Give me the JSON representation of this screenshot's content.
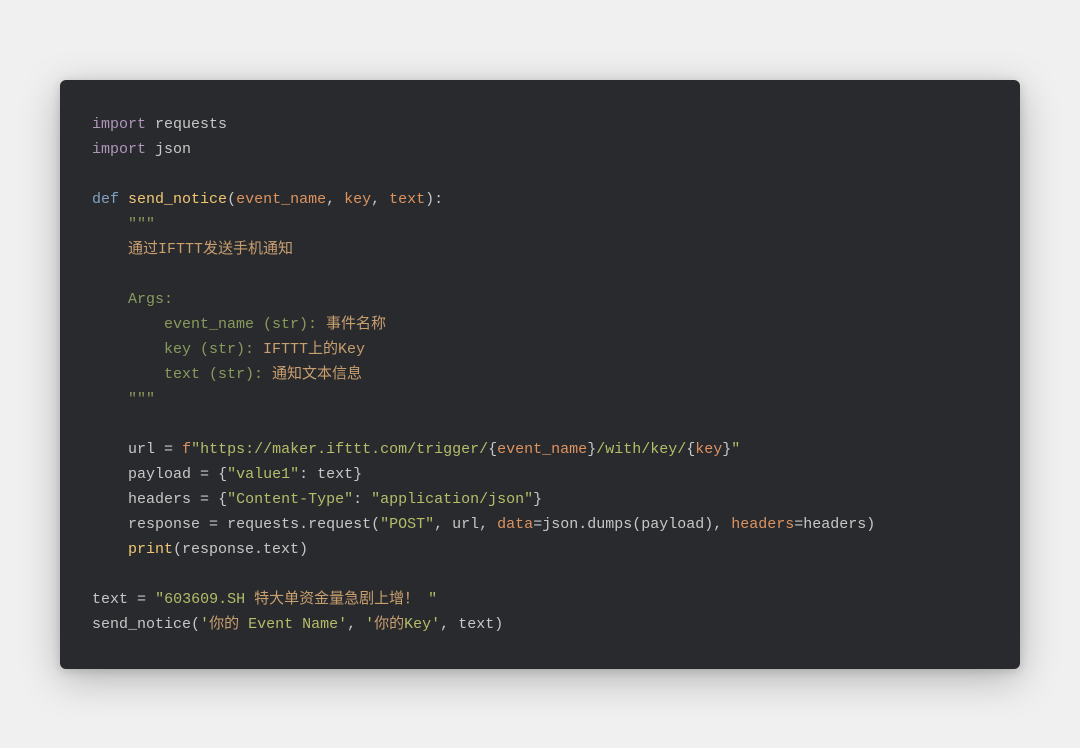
{
  "code": {
    "line1": {
      "kw": "import",
      "mod": "requests"
    },
    "line2": {
      "kw": "import",
      "mod": "json"
    },
    "line4": {
      "kw": "def",
      "fn": "send_notice",
      "p1": "event_name",
      "p2": "key",
      "p3": "text"
    },
    "line5": "\"\"\"",
    "line6": "通过IFTTT发送手机通知",
    "line8": "Args:",
    "line9a": "event_name (str): ",
    "line9b": "事件名称",
    "line10a": "key (str): ",
    "line10b": "IFTTT上的Key",
    "line11a": "text (str): ",
    "line11b": "通知文本信息",
    "line12": "\"\"\"",
    "line14_var": "url",
    "line14_fprefix": "f",
    "line14_s1": "\"https://maker.ifttt.com/trigger/",
    "line14_i1": "event_name",
    "line14_s2": "/with/key/",
    "line14_i2": "key",
    "line14_s3": "\"",
    "line15_var": "payload",
    "line15_key": "\"value1\"",
    "line15_val": "text",
    "line16_var": "headers",
    "line16_key": "\"Content-Type\"",
    "line16_val": "\"application/json\"",
    "line17_var": "response",
    "line17_call1": "requests.request(",
    "line17_post": "\"POST\"",
    "line17_url": "url",
    "line17_data": "data",
    "line17_json": "json.dumps(payload)",
    "line17_hdrs": "headers",
    "line17_hdrs2": "headers)",
    "line18_print": "print",
    "line18_arg": "(response.text)",
    "line20_var": "text",
    "line20_s1": "\"603609.SH ",
    "line20_s2": "特大单资金量急剧上增！",
    "line20_s3": " \"",
    "line21_fn": "send_notice",
    "line21_a1a": "'",
    "line21_a1b": "你的",
    "line21_a1c": " Event Name'",
    "line21_a2a": "'",
    "line21_a2b": "你的",
    "line21_a2c": "Key'",
    "line21_a3": "text"
  }
}
